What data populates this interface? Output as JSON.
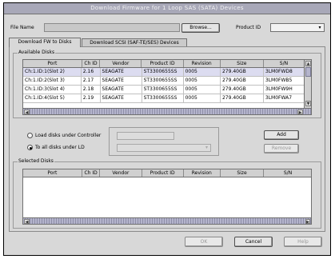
{
  "window": {
    "title": "Download Firmware for 1 Loop SAS (SATA) Devices"
  },
  "top": {
    "filename_label": "File Name",
    "filename_value": "",
    "browse_label": "Browse...",
    "product_id_label": "Product ID",
    "product_id_value": ""
  },
  "tabs": [
    {
      "label": "Download FW to Disks"
    },
    {
      "label": "Download SCSI (SAF-TE/SES) Devices"
    }
  ],
  "available": {
    "title": "Available Disks",
    "columns": [
      "Port",
      "Ch ID",
      "Vendor",
      "Product ID",
      "Revision",
      "Size",
      "S/N"
    ],
    "rows": [
      [
        "Ch:1.ID:1(Slot 2)",
        "2.16",
        "SEAGATE",
        "ST3300655SS",
        "0005",
        "279.40GB",
        "3LM0FWD8"
      ],
      [
        "Ch:1.ID:2(Slot 3)",
        "2.17",
        "SEAGATE",
        "ST3300655SS",
        "0005",
        "279.40GB",
        "3LM0FWB5"
      ],
      [
        "Ch:1.ID:3(Slot 4)",
        "2.18",
        "SEAGATE",
        "ST3300655SS",
        "0005",
        "279.40GB",
        "3LM0FW9H"
      ],
      [
        "Ch:1.ID:4(Slot 5)",
        "2.19",
        "SEAGATE",
        "ST3300655SS",
        "0005",
        "279.40GB",
        "3LM0FWA7"
      ]
    ]
  },
  "options": {
    "radio1_label": "Load disks under Controller",
    "radio2_label": "To all disks under LD",
    "combo1_value": "",
    "combo2_value": "",
    "add_label": "Add",
    "remove_label": "Remove"
  },
  "selected": {
    "title": "Selected Disks",
    "columns": [
      "Port",
      "Ch ID",
      "Vendor",
      "Product ID",
      "Revision",
      "Size",
      "S/N"
    ]
  },
  "footer": {
    "ok_label": "OK",
    "cancel_label": "Cancel",
    "help_label": "Help"
  }
}
